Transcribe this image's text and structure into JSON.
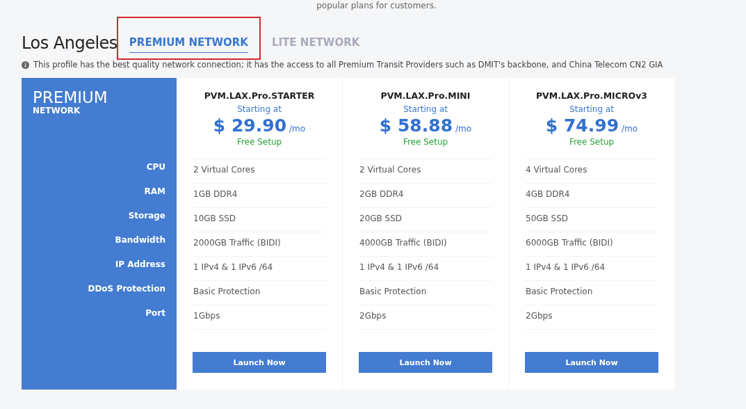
{
  "intro_text": "popular plans for customers.",
  "location": "Los Angeles",
  "tabs": [
    {
      "label": "PREMIUM NETWORK",
      "selected": true,
      "highlighted": true
    },
    {
      "label": "LITE NETWORK",
      "selected": false,
      "highlighted": false
    }
  ],
  "info": "This profile has the best quality network connection; it has the access to all Premium Transit Providers such as DMIT's backbone, and China Telecom CN2 GIA",
  "panel": {
    "title": "PREMIUM",
    "subtitle": "NETWORK",
    "spec_labels": [
      "CPU",
      "RAM",
      "Storage",
      "Bandwidth",
      "IP Address",
      "DDoS Protection",
      "Port"
    ]
  },
  "plans": [
    {
      "name": "PVM.LAX.Pro.STARTER",
      "starting": "Starting at",
      "price": "$ 29.90",
      "period": "/mo",
      "setup": "Free Setup",
      "specs": [
        "2 Virtual Cores",
        "1GB DDR4",
        "10GB SSD",
        "2000GB Traffic (BIDI)",
        "1 IPv4 & 1 IPv6 /64",
        "Basic Protection",
        "1Gbps"
      ],
      "button": "Launch Now"
    },
    {
      "name": "PVM.LAX.Pro.MINI",
      "starting": "Starting at",
      "price": "$ 58.88",
      "period": "/mo",
      "setup": "Free Setup",
      "specs": [
        "2 Virtual Cores",
        "2GB DDR4",
        "20GB SSD",
        "4000GB Traffic (BIDI)",
        "1 IPv4 & 1 IPv6 /64",
        "Basic Protection",
        "2Gbps"
      ],
      "button": "Launch Now"
    },
    {
      "name": "PVM.LAX.Pro.MICROv3",
      "starting": "Starting at",
      "price": "$ 74.99",
      "period": "/mo",
      "setup": "Free Setup",
      "specs": [
        "4 Virtual Cores",
        "4GB DDR4",
        "50GB SSD",
        "6000GB Traffic (BIDI)",
        "1 IPv4 & 1 IPv6 /64",
        "Basic Protection",
        "2Gbps"
      ],
      "button": "Launch Now"
    }
  ]
}
